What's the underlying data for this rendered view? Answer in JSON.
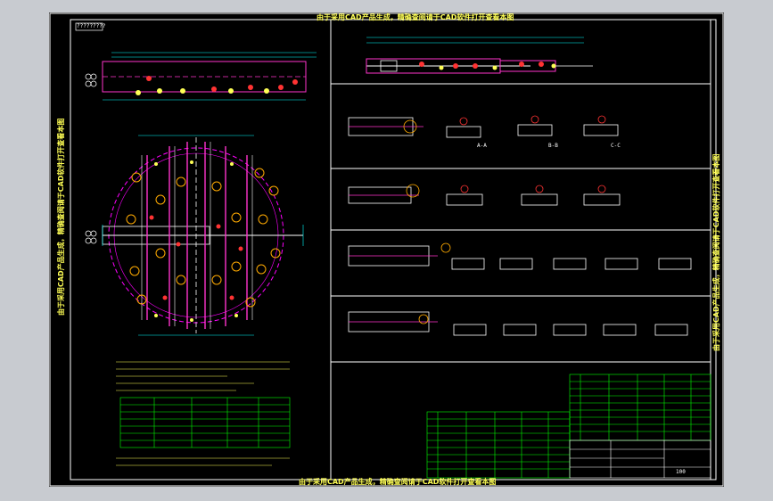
{
  "drawing": {
    "title_top": "由于采用CAD产品生成，精确查阅请于CAD软件打开查看本图",
    "title_bottom": "由于采用CAD产品生成，精确查阅请于CAD软件打开查看本图",
    "side_left": "由于采用CAD产品生成，精确查阅请于CAD软件打开查看本图",
    "side_right": "由于采用CAD产品生成，精确查阅请于CAD软件打开查看本图",
    "frame_tag": "?????????",
    "sections": [
      "A-A",
      "B-B",
      "C-C"
    ],
    "page_no": "100"
  },
  "colors": {
    "background": "#000000",
    "frame": "#ffffff",
    "outline": "#ff00ff",
    "pipe": "#ff33cc",
    "dimension": "#00ffff",
    "text": "#ffff55",
    "table_line": "#00ff00"
  }
}
